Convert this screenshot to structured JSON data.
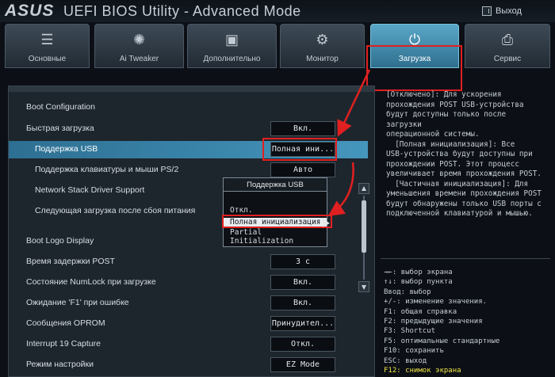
{
  "header": {
    "brand": "ASUS",
    "title": "UEFI BIOS Utility - Advanced Mode",
    "exit_label": "Выход"
  },
  "tabs": [
    {
      "label": "Основные",
      "icon": "list-icon"
    },
    {
      "label": "Ai Tweaker",
      "icon": "tweaker-icon"
    },
    {
      "label": "Дополнительно",
      "icon": "advanced-icon"
    },
    {
      "label": "Монитор",
      "icon": "monitor-icon"
    },
    {
      "label": "Загрузка",
      "icon": "power-icon"
    },
    {
      "label": "Сервис",
      "icon": "printer-icon"
    }
  ],
  "main": {
    "section": "Boot Configuration",
    "rows": [
      {
        "label": "Быстрая загрузка",
        "value": "Вкл."
      },
      {
        "label": "Поддержка USB",
        "value": "Полная ини..."
      },
      {
        "label": "Поддержка клавиатуры и мыши PS/2",
        "value": "Авто"
      },
      {
        "label": "Network Stack Driver Support",
        "value": ""
      },
      {
        "label": "Следующая загрузка после сбоя питания",
        "value": ""
      },
      {
        "label": "Boot Logo Display",
        "value": ""
      },
      {
        "label": "Время задержки POST",
        "value": "3 с"
      },
      {
        "label": "Состояние NumLock при загрузке",
        "value": "Вкл."
      },
      {
        "label": "Ожидание 'F1' при ошибке",
        "value": "Вкл."
      },
      {
        "label": "Сообщения OPROM",
        "value": "Принудител..."
      },
      {
        "label": "Interrupt 19 Capture",
        "value": "Откл."
      },
      {
        "label": "Режим настройки",
        "value": "EZ Mode"
      }
    ]
  },
  "popup": {
    "title": "Поддержка USB",
    "options": [
      "Откл.",
      "Полная инициализация",
      "Partial Initialization"
    ]
  },
  "help_text": "[Отключено]: Для ускорения\nпрохождения POST USB-устройства\nбудут доступны только после загрузки\nоперационной системы.\n  [Полная инициализация]: Все\nUSB-устройства будут доступны при\nпрохождении POST. Этот процесс\nувеличивает время прохождения POST.\n  [Частичная инициализация]: Для\nуменьшения времени прохождения POST\nбудут обнаружены только USB порты с\nподключенной клавиатурой и мышью.",
  "keys": [
    "→←: выбор экрана",
    "↑↓: выбор пункта",
    "Ввод: выбор",
    "+/-: изменение значения.",
    "F1: общая справка",
    "F2: предыдущие значения",
    "F3: Shortcut",
    "F5: оптимальные стандартные",
    "F10: сохранить",
    "ESC: выход",
    "F12: снимок экрана"
  ],
  "colors": {
    "accent": "#4596bd",
    "highlight_box": "#e02020",
    "background": "#1e262d",
    "shortcut_yellow": "#f0e447"
  }
}
